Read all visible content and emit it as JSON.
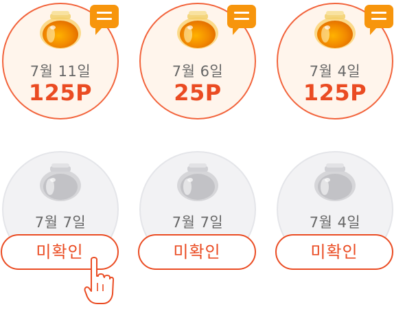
{
  "confirmed": [
    {
      "date": "7월 11일",
      "points": "125P",
      "icon": "honey-jar-icon",
      "badge_icon": "chat-icon"
    },
    {
      "date": "7월 6일",
      "points": "25P",
      "icon": "honey-jar-icon",
      "badge_icon": "chat-icon"
    },
    {
      "date": "7월 4일",
      "points": "125P",
      "icon": "honey-jar-icon",
      "badge_icon": "chat-icon"
    }
  ],
  "unconfirmed": [
    {
      "date": "7월 7일",
      "button_label": "미확인",
      "icon": "empty-jar-icon"
    },
    {
      "date": "7월 7일",
      "button_label": "미확인",
      "icon": "empty-jar-icon"
    },
    {
      "date": "7월 4일",
      "button_label": "미확인",
      "icon": "empty-jar-icon"
    }
  ],
  "pointer_icon": "hand-pointer-icon",
  "colors": {
    "accent": "#ea4b22",
    "badge": "#f7950c",
    "active_bg": "#fff5ec",
    "inactive_bg": "#f2f2f4",
    "date_text": "#666666"
  }
}
